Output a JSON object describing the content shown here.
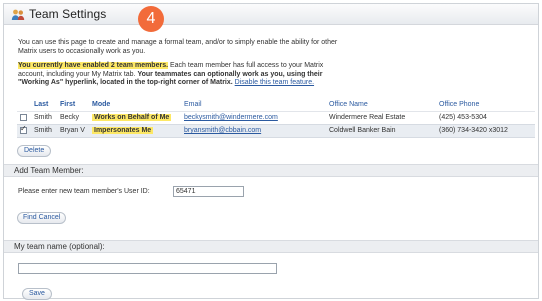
{
  "header": {
    "title": "Team Settings",
    "step_badge": "4"
  },
  "intro": {
    "line1": "You can use this page to create and manage a formal team, and/or to simply enable the ability for other",
    "line2": "Matrix users to occasionally work as you."
  },
  "notice": {
    "highlight": "You currently have enabled 2 team members.",
    "text1": " Each team member has full access to your Matrix",
    "text2": "account, including your My Matrix tab. ",
    "bold1": "Your teammates can optionally work as you, using their",
    "bold2": "\"Working As\" hyperlink, located in the top-right corner of Matrix.",
    "link": "Disable this team feature."
  },
  "table": {
    "headers": [
      "Last",
      "First",
      "Mode",
      "Email",
      "Office Name",
      "Office Phone"
    ],
    "rows": [
      {
        "checked": false,
        "last": "Smith",
        "first": "Becky",
        "mode": "Works on Behalf of Me",
        "email": "beckysmith@windermere.com",
        "office": "Windermere Real Estate",
        "phone": "(425) 453-5304"
      },
      {
        "checked": true,
        "last": "Smith",
        "first": "Bryan V",
        "mode": "Impersonates Me",
        "email": "bryansmith@cbbain.com",
        "office": "Coldwell Banker Bain",
        "phone": "(360) 734-3420 x3012"
      }
    ]
  },
  "buttons": {
    "delete": "Delete",
    "find": "Find",
    "cancel": "Cancel",
    "save": "Save"
  },
  "add_member": {
    "header": "Add Team Member:",
    "label": "Please enter new team member's User ID:",
    "value": "65471"
  },
  "team_name": {
    "header": "My team name (optional):",
    "value": ""
  },
  "colors": {
    "accent": "#f26b3a",
    "link": "#2b5aa0",
    "highlight": "#fde865"
  }
}
